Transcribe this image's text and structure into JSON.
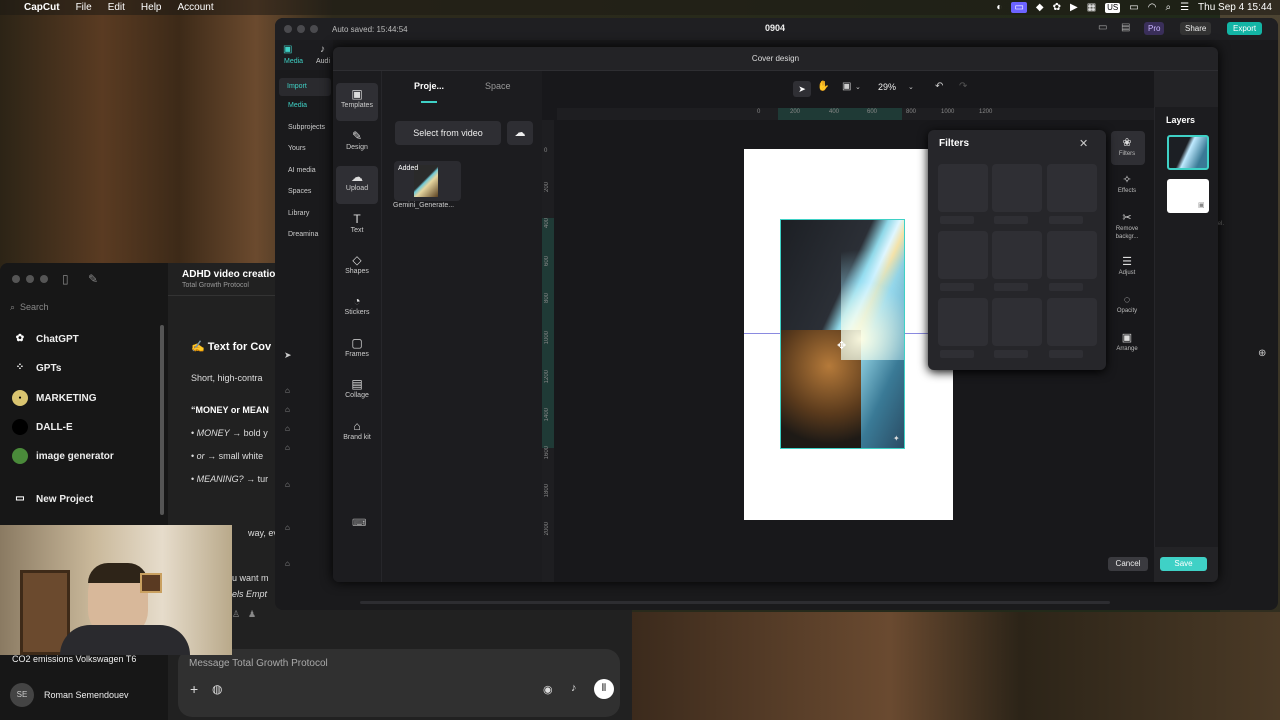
{
  "menubar": {
    "app": "CapCut",
    "items": [
      "File",
      "Edit",
      "Help",
      "Account"
    ],
    "lang": "US",
    "datetime": "Thu Sep 4  15:44"
  },
  "chatgpt": {
    "search_placeholder": "Search",
    "sidebar": [
      {
        "label": "ChatGPT"
      },
      {
        "label": "GPTs"
      },
      {
        "label": "MARKETING"
      },
      {
        "label": "DALL-E"
      },
      {
        "label": "image generator"
      },
      {
        "label": "New Project"
      }
    ],
    "recent_chat": "CO2 emissions Volkswagen T6",
    "user_initials": "SE",
    "user_name": "Roman Semendouev",
    "chat_title": "ADHD video creatio",
    "chat_subtitle": "Total Growth Protocol",
    "heading": "✍️ Text for Cov",
    "p1": "Short, high-contra",
    "quote": "“MONEY or MEAN",
    "bullets": [
      {
        "em": "MONEY",
        "rest": " → bold y"
      },
      {
        "em": "or",
        "rest": " → small white"
      },
      {
        "em": "MEANING?",
        "rest": " → tur"
      }
    ],
    "frag1": "way, even",
    "frag2": "u want m",
    "frag3": "els Empt",
    "composer_placeholder": "Message Total Growth Protocol"
  },
  "capcut": {
    "autosave": "Auto saved: 15:44:54",
    "project": "0904",
    "pro_label": "Pro",
    "share_label": "Share",
    "export_label": "Export",
    "top_tabs": [
      "Media",
      "Audi"
    ],
    "left_nav": [
      "Import",
      "Media",
      "Subprojects",
      "Yours",
      "AI media",
      "Spaces",
      "Library",
      "Dreamina"
    ],
    "bg_right_text": "level."
  },
  "dialog": {
    "title": "Cover design",
    "tools": [
      {
        "label": "Templates",
        "icon": "templates-icon",
        "g": "▣"
      },
      {
        "label": "Design",
        "icon": "design-icon",
        "g": "✎"
      },
      {
        "label": "Upload",
        "icon": "upload-icon",
        "g": "☁"
      },
      {
        "label": "Text",
        "icon": "text-icon",
        "g": "T"
      },
      {
        "label": "Shapes",
        "icon": "shapes-icon",
        "g": "◇"
      },
      {
        "label": "Stickers",
        "icon": "stickers-icon",
        "g": "◔"
      },
      {
        "label": "Frames",
        "icon": "frames-icon",
        "g": "▢"
      },
      {
        "label": "Collage",
        "icon": "collage-icon",
        "g": "▤"
      },
      {
        "label": "Brand kit",
        "icon": "brand-kit-icon",
        "g": "⌂"
      }
    ],
    "asset_tabs": [
      "Proje...",
      "Space"
    ],
    "select_video": "Select from video",
    "thumb_badge": "Added",
    "thumb_name": "Gemini_Generate...",
    "zoom": "29%",
    "ruler_x": [
      "0",
      "200",
      "400",
      "600",
      "800",
      "1000",
      "1200"
    ],
    "ruler_y": [
      "0",
      "200",
      "400",
      "600",
      "800",
      "1000",
      "1200",
      "1400",
      "1600",
      "1800",
      "2000"
    ],
    "filters_title": "Filters",
    "right_tools": [
      {
        "label": "Filters",
        "g": "❀"
      },
      {
        "label": "Effects",
        "g": "✧"
      },
      {
        "label": "Remove backgr...",
        "g": "✂"
      },
      {
        "label": "Adjust",
        "g": "☰"
      },
      {
        "label": "Opacity",
        "g": "◌"
      },
      {
        "label": "Arrange",
        "g": "▣"
      }
    ],
    "layers_title": "Layers",
    "cancel": "Cancel",
    "save": "Save"
  },
  "colors": {
    "accent": "#3fd1c6",
    "save_bg": "#3fd1c6",
    "export_bg": "#13b5a5",
    "pro": "#8b5cf6"
  }
}
